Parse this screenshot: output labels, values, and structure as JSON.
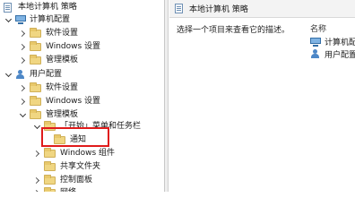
{
  "tree": {
    "root_label": "本地计算机 策略",
    "computer_config": "计算机配置",
    "cc_software": "软件设置",
    "cc_windows": "Windows 设置",
    "cc_admin": "管理模板",
    "user_config": "用户配置",
    "uc_software": "软件设置",
    "uc_windows": "Windows 设置",
    "uc_admin": "管理模板",
    "start_menu": "「开始」菜单和任务栏",
    "notifications": "通知",
    "windows_components": "Windows 组件",
    "shared_folders": "共享文件夹",
    "control_panel": "控制面板",
    "network": "网络"
  },
  "details": {
    "header_title": "本地计算机 策略",
    "description": "选择一个项目来查看它的描述。",
    "column_name": "名称",
    "items": [
      "计算机配置",
      "用户配置"
    ]
  },
  "colors": {
    "highlight_box": "#e01b1b",
    "folder": "#f0d682"
  }
}
